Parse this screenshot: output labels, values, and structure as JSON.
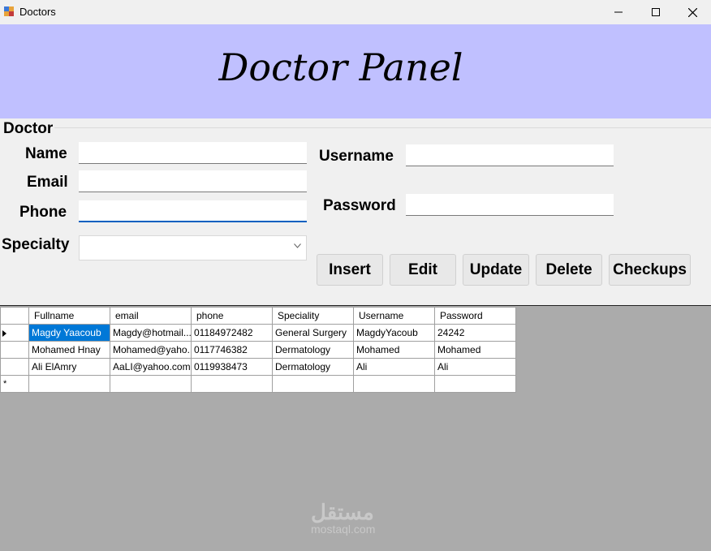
{
  "window": {
    "title": "Doctors",
    "icons": [
      "app-icon",
      "minimize-icon",
      "maximize-icon",
      "close-icon"
    ]
  },
  "banner": {
    "title": "Doctor Panel",
    "background": "#c0c0ff"
  },
  "form": {
    "group_label": "Doctor",
    "name_label": "Name",
    "name_value": "",
    "email_label": "Email",
    "email_value": "",
    "phone_label": "Phone",
    "phone_value": "",
    "specialty_label": "Specialty",
    "specialty_value": "",
    "username_label": "Username",
    "username_value": "",
    "password_label": "Password",
    "password_value": ""
  },
  "buttons": {
    "insert": "Insert",
    "edit": "Edit",
    "update": "Update",
    "delete": "Delete",
    "checkups": "Checkups"
  },
  "grid": {
    "columns": [
      "Fullname",
      "email",
      "phone",
      "Speciality",
      "Username",
      "Password"
    ],
    "rows": [
      [
        "Magdy Yaacoub",
        "Magdy@hotmail....",
        "01184972482",
        "General Surgery",
        "MagdyYacoub",
        "24242"
      ],
      [
        "Mohamed Hnay",
        "Mohamed@yaho...",
        "0117746382",
        "Dermatology",
        "Mohamed",
        "Mohamed"
      ],
      [
        "Ali ElAmry",
        "AaLI@yahoo.com",
        "0119938473",
        "Dermatology",
        "Ali",
        "Ali"
      ]
    ],
    "new_row_marker": "*",
    "selection_color": "#0078d7"
  },
  "watermark": {
    "arabic": "مستقل",
    "latin": "mostaql.com"
  }
}
